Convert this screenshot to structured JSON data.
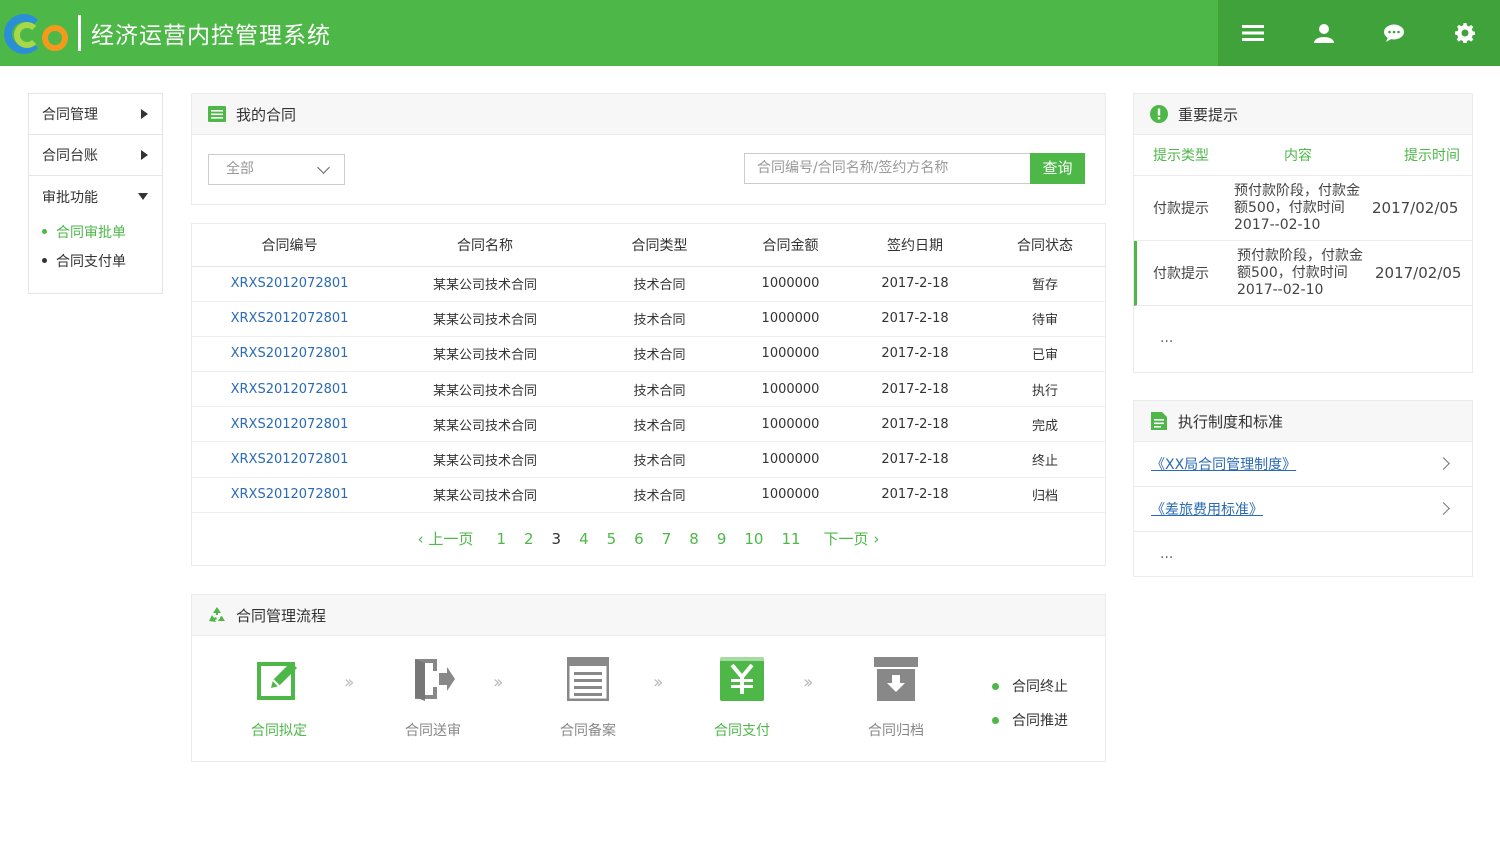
{
  "app": {
    "title": "经济运营内控管理系统"
  },
  "colors": {
    "primary": "#4db848",
    "primary_dark": "#3fa23b",
    "link": "#2a6bb3"
  },
  "toolbar": {
    "icons": [
      "menu-icon",
      "user-icon",
      "chat-icon",
      "gear-icon"
    ]
  },
  "sidebar": {
    "items": [
      {
        "label": "合同管理"
      },
      {
        "label": "合同台账"
      },
      {
        "label": "审批功能"
      }
    ],
    "sub_items": [
      {
        "label": "合同审批单",
        "active": true
      },
      {
        "label": "合同支付单",
        "active": false
      }
    ]
  },
  "contracts": {
    "title": "我的合同",
    "filter": {
      "selected": "全部"
    },
    "search": {
      "placeholder": "合同编号/合同名称/签约方名称",
      "button": "查询"
    },
    "columns": [
      "合同编号",
      "合同名称",
      "合同类型",
      "合同金额",
      "签约日期",
      "合同状态"
    ],
    "rows": [
      [
        "XRXS2012072801",
        "某某公司技术合同",
        "技术合同",
        "1000000",
        "2017-2-18",
        "暂存"
      ],
      [
        "XRXS2012072801",
        "某某公司技术合同",
        "技术合同",
        "1000000",
        "2017-2-18",
        "待审"
      ],
      [
        "XRXS2012072801",
        "某某公司技术合同",
        "技术合同",
        "1000000",
        "2017-2-18",
        "已审"
      ],
      [
        "XRXS2012072801",
        "某某公司技术合同",
        "技术合同",
        "1000000",
        "2017-2-18",
        "执行"
      ],
      [
        "XRXS2012072801",
        "某某公司技术合同",
        "技术合同",
        "1000000",
        "2017-2-18",
        "完成"
      ],
      [
        "XRXS2012072801",
        "某某公司技术合同",
        "技术合同",
        "1000000",
        "2017-2-18",
        "终止"
      ],
      [
        "XRXS2012072801",
        "某某公司技术合同",
        "技术合同",
        "1000000",
        "2017-2-18",
        "归档"
      ]
    ],
    "pager": {
      "prev": "上一页",
      "next": "下一页",
      "pages": [
        "1",
        "2",
        "3",
        "4",
        "5",
        "6",
        "7",
        "8",
        "9",
        "10",
        "11"
      ]
    }
  },
  "flow": {
    "title": "合同管理流程",
    "steps": [
      {
        "label": "合同拟定",
        "icon": "edit-icon",
        "status": "green"
      },
      {
        "label": "合同送审",
        "icon": "door-exit-icon",
        "status": "gray"
      },
      {
        "label": "合同备案",
        "icon": "document-icon",
        "status": "gray"
      },
      {
        "label": "合同支付",
        "icon": "yen-icon",
        "status": "green"
      },
      {
        "label": "合同归档",
        "icon": "archive-icon",
        "status": "gray"
      }
    ],
    "legend": [
      "合同终止",
      "合同推进"
    ]
  },
  "tips": {
    "title": "重要提示",
    "columns": [
      "提示类型",
      "内容",
      "提示时间"
    ],
    "rows": [
      {
        "type": "付款提示",
        "content": "预付款阶段，付款金额500，付款时间2017--02-10",
        "time": "2017/02/05"
      },
      {
        "type": "付款提示",
        "content": "预付款阶段，付款金额500，付款时间2017--02-10",
        "time": "2017/02/05"
      }
    ],
    "more": "..."
  },
  "standards": {
    "title": "执行制度和标准",
    "items": [
      "《XX局合同管理制度》",
      "《差旅费用标准》"
    ],
    "more": "..."
  }
}
